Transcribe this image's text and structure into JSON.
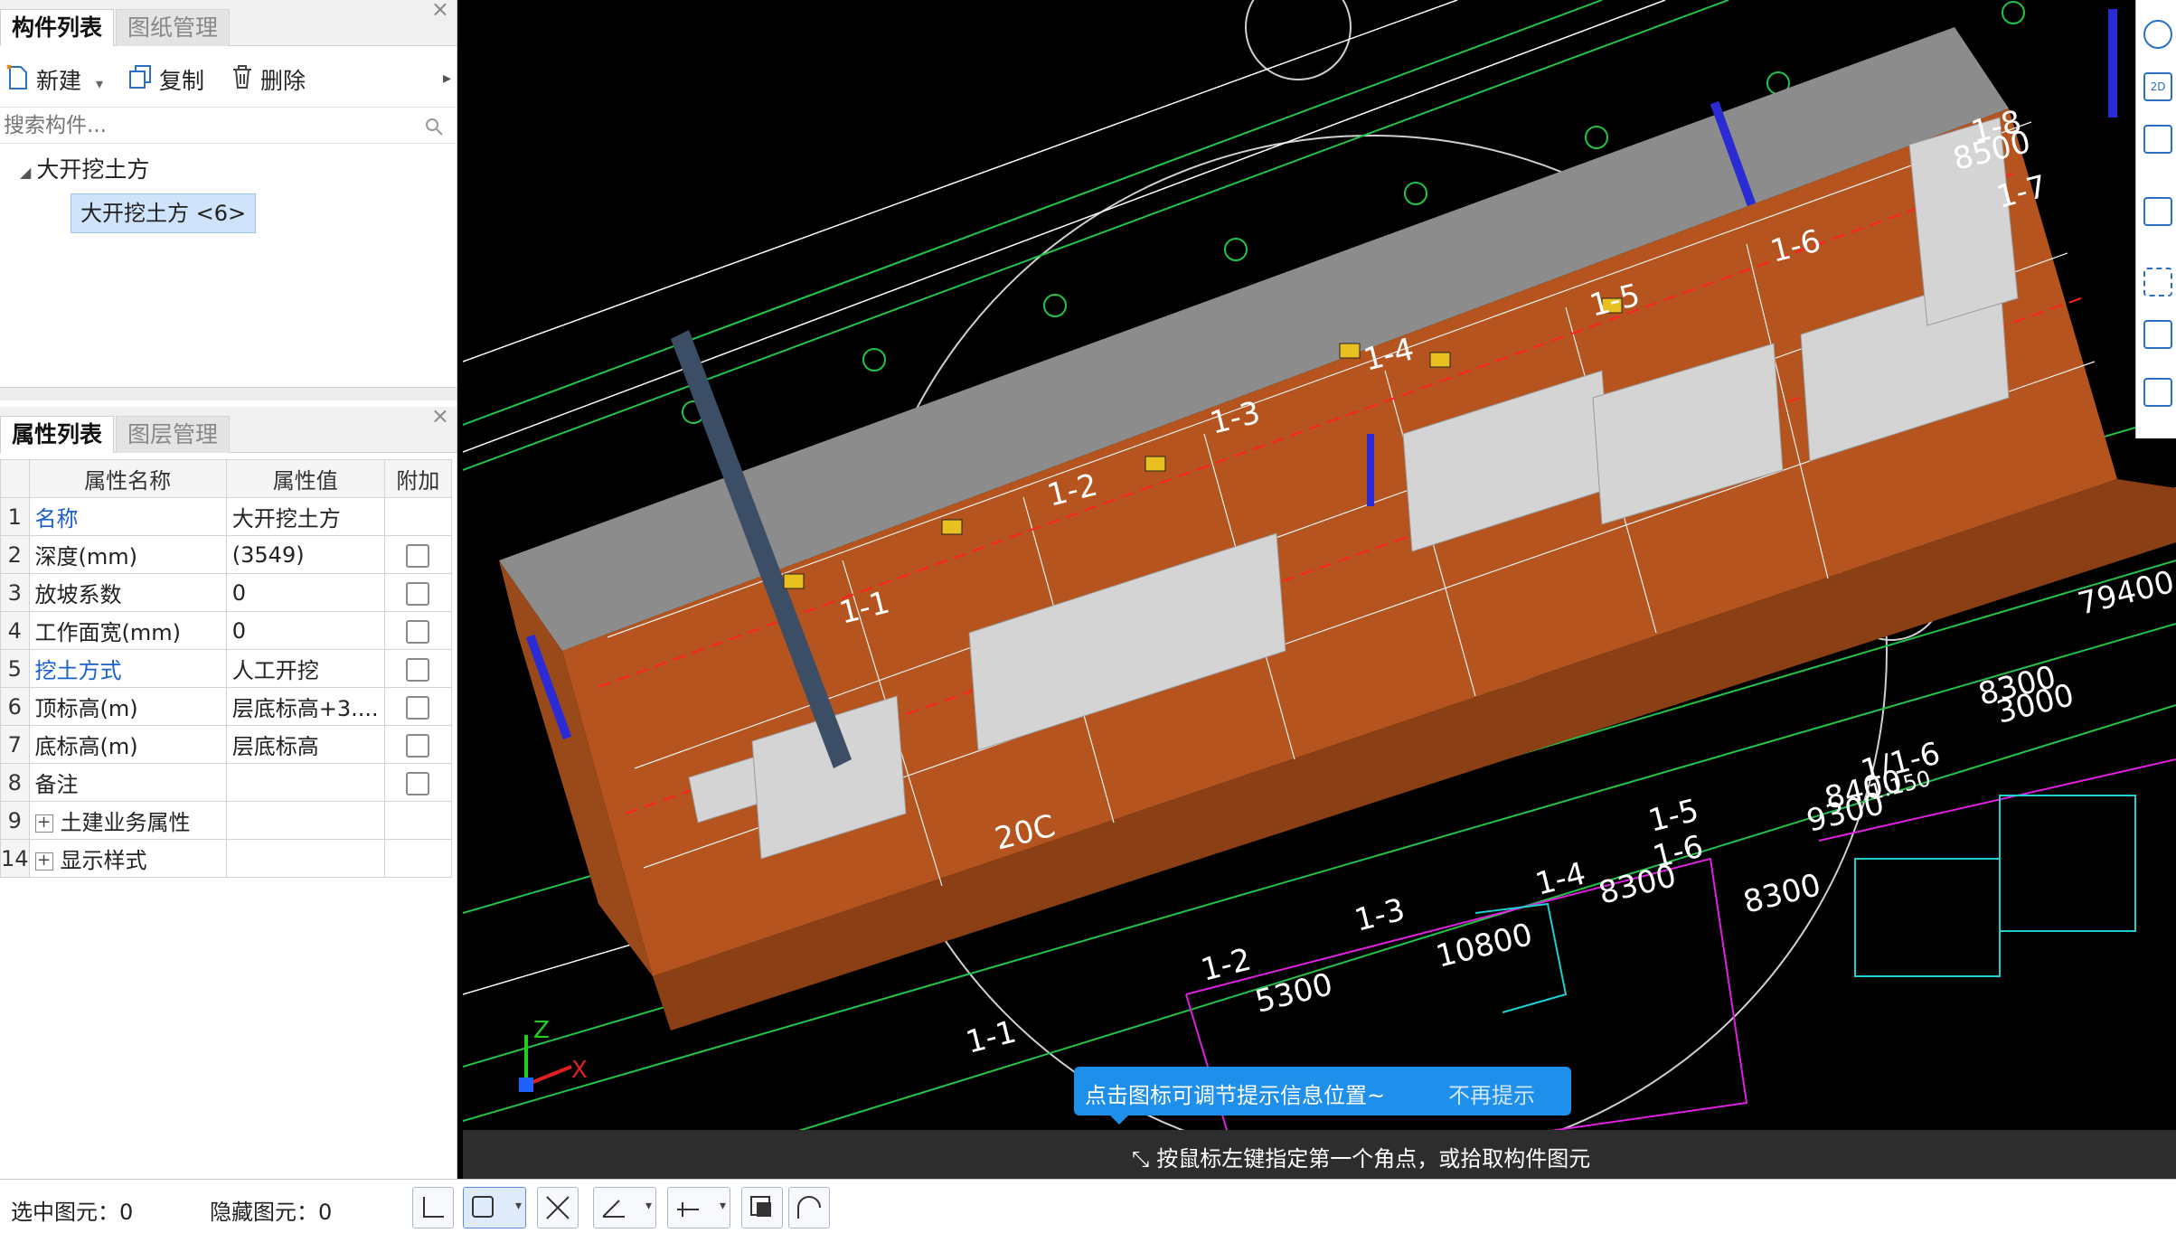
{
  "component_panel": {
    "tabs": [
      "构件列表",
      "图纸管理"
    ],
    "toolbar": {
      "new": "新建",
      "copy": "复制",
      "delete": "删除"
    },
    "search_placeholder": "搜索构件...",
    "tree": {
      "group": "大开挖土方",
      "selected_item": "大开挖土方 <6>"
    }
  },
  "property_panel": {
    "tabs": [
      "属性列表",
      "图层管理"
    ],
    "columns": [
      "属性名称",
      "属性值",
      "附加"
    ],
    "rows": [
      {
        "no": "1",
        "name": "名称",
        "value": "大开挖土方",
        "link": true,
        "checkbox": false
      },
      {
        "no": "2",
        "name": "深度(mm)",
        "value": "(3549)",
        "link": false,
        "checkbox": true
      },
      {
        "no": "3",
        "name": "放坡系数",
        "value": "0",
        "link": false,
        "checkbox": true
      },
      {
        "no": "4",
        "name": "工作面宽(mm)",
        "value": "0",
        "link": false,
        "checkbox": true
      },
      {
        "no": "5",
        "name": "挖土方式",
        "value": "人工开挖",
        "link": true,
        "checkbox": true
      },
      {
        "no": "6",
        "name": "顶标高(m)",
        "value": "层底标高+3....",
        "link": false,
        "checkbox": true
      },
      {
        "no": "7",
        "name": "底标高(m)",
        "value": "层底标高",
        "link": false,
        "checkbox": true
      },
      {
        "no": "8",
        "name": "备注",
        "value": "",
        "link": false,
        "checkbox": true
      },
      {
        "no": "9",
        "name": "土建业务属性",
        "value": "",
        "link": false,
        "checkbox": false,
        "expand": true
      },
      {
        "no": "14",
        "name": "显示样式",
        "value": "",
        "link": false,
        "checkbox": false,
        "expand": true
      }
    ]
  },
  "viewport": {
    "dimension_labels": [
      "8500",
      "1-8",
      "1-7",
      "1-6",
      "1-5",
      "1-4",
      "1-3",
      "1-2",
      "1-1",
      "8400",
      "8300",
      "8300",
      "8300",
      "10800",
      "5300",
      "3000",
      "79400",
      "9300",
      "1:150",
      "1/1-6",
      "1-6",
      "1-5",
      "1-4",
      "1-3",
      "1-2",
      "1-1",
      "20C"
    ],
    "tip": {
      "message": "点击图标可调节提示信息位置~",
      "dismiss": "不再提示"
    },
    "hint": "按鼠标左键指定第一个角点，或拾取构件图元",
    "axes": {
      "x": "X",
      "z": "Z"
    }
  },
  "status_bar": {
    "selected_label": "选中图元：",
    "selected_count": "0",
    "hidden_label": "隐藏图元：",
    "hidden_count": "0"
  },
  "colors": {
    "accent": "#1e8fea",
    "soil": "#b5541e",
    "wall": "#cfcfcf",
    "cad_green": "#22c34b",
    "cad_magenta": "#e020e0"
  }
}
